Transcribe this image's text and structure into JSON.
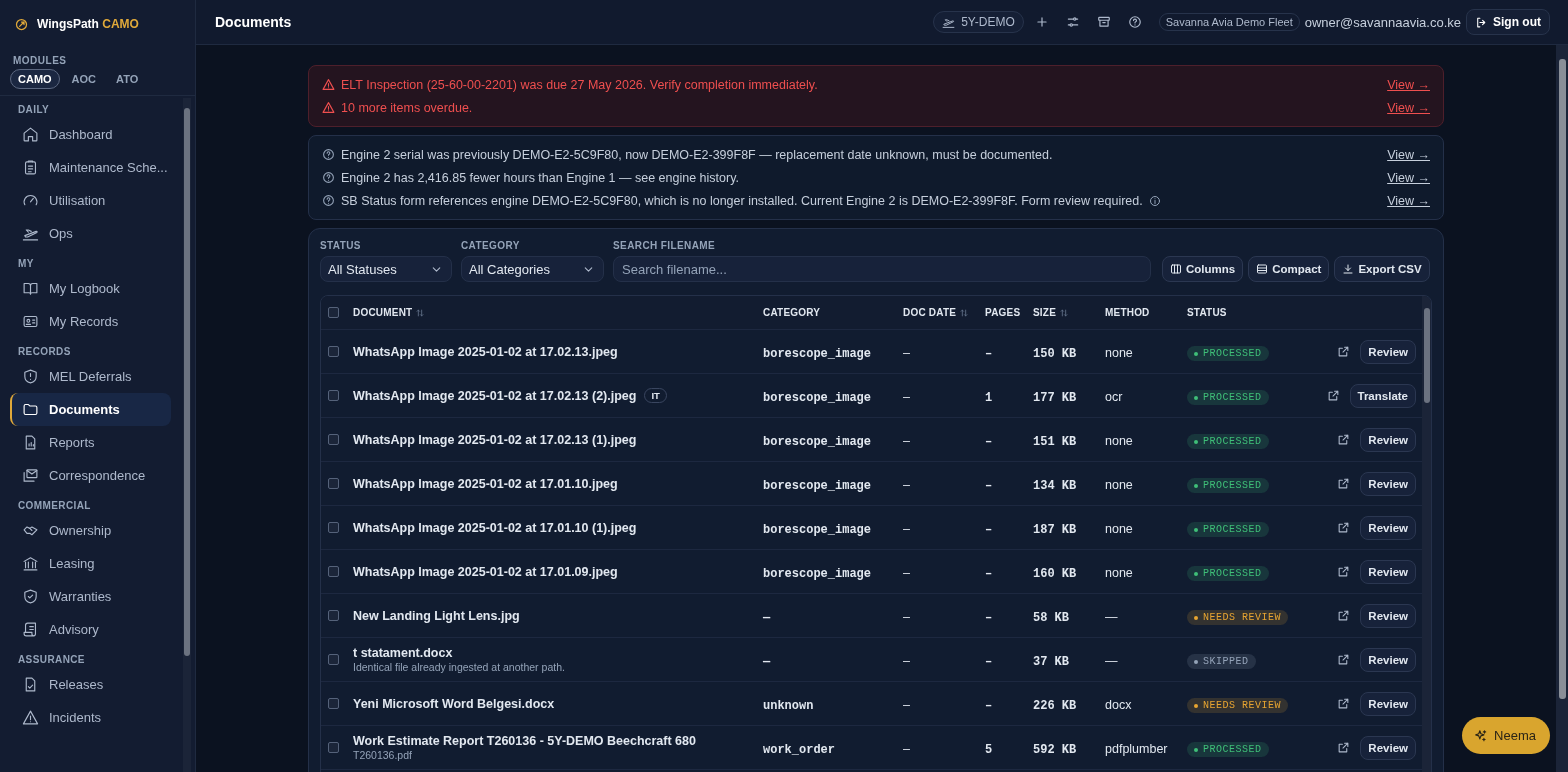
{
  "brand": {
    "name": "WingsPath",
    "product": "CAMO"
  },
  "modules": {
    "label": "MODULES",
    "items": [
      {
        "label": "CAMO",
        "selected": true
      },
      {
        "label": "AOC",
        "selected": false
      },
      {
        "label": "ATO",
        "selected": false
      }
    ]
  },
  "sidebar": {
    "sections": [
      {
        "title": "DAILY",
        "items": [
          {
            "label": "Dashboard",
            "selected": false
          },
          {
            "label": "Maintenance Sche...",
            "selected": false
          },
          {
            "label": "Utilisation",
            "selected": false
          },
          {
            "label": "Ops",
            "selected": false
          }
        ]
      },
      {
        "title": "MY",
        "items": [
          {
            "label": "My Logbook",
            "selected": false
          },
          {
            "label": "My Records",
            "selected": false
          }
        ]
      },
      {
        "title": "RECORDS",
        "items": [
          {
            "label": "MEL Deferrals",
            "selected": false
          },
          {
            "label": "Documents",
            "selected": true
          },
          {
            "label": "Reports",
            "selected": false
          },
          {
            "label": "Correspondence",
            "selected": false
          }
        ]
      },
      {
        "title": "COMMERCIAL",
        "items": [
          {
            "label": "Ownership",
            "selected": false
          },
          {
            "label": "Leasing",
            "selected": false
          },
          {
            "label": "Warranties",
            "selected": false
          },
          {
            "label": "Advisory",
            "selected": false
          }
        ]
      },
      {
        "title": "ASSURANCE",
        "items": [
          {
            "label": "Releases",
            "selected": false
          },
          {
            "label": "Incidents",
            "selected": false
          }
        ]
      }
    ]
  },
  "topbar": {
    "title": "Documents",
    "aircraft": "5Y-DEMO",
    "fleet": "Savanna Avia Demo Fleet",
    "user": "owner@savannaavia.co.ke",
    "sign_out": "Sign out"
  },
  "alerts": [
    {
      "text": "ELT Inspection (25-60-00-2201) was due 27 May 2026. Verify completion immediately.",
      "link": "View →"
    },
    {
      "text": "10 more items overdue.",
      "link": "View →"
    }
  ],
  "notices": [
    {
      "text": "Engine 2 serial was previously DEMO-E2-5C9F80, now DEMO-E2-399F8F — replacement date unknown, must be documented.",
      "info": false,
      "link": "View →"
    },
    {
      "text": "Engine 2 has 2,416.85 fewer hours than Engine 1 — see engine history.",
      "info": false,
      "link": "View →"
    },
    {
      "text": "SB Status form references engine DEMO-E2-5C9F80, which is no longer installed. Current Engine 2 is DEMO-E2-399F8F. Form review required.",
      "info": true,
      "link": "View →"
    }
  ],
  "filters": {
    "status": {
      "label": "STATUS",
      "value": "All Statuses"
    },
    "category": {
      "label": "CATEGORY",
      "value": "All Categories"
    },
    "search": {
      "label": "SEARCH FILENAME",
      "placeholder": "Search filename..."
    },
    "buttons": [
      "Columns",
      "Compact",
      "Export CSV"
    ]
  },
  "table": {
    "all_checked": false,
    "columns": [
      {
        "label": "DOCUMENT",
        "sortable": true
      },
      {
        "label": "CATEGORY",
        "sortable": false
      },
      {
        "label": "DOC DATE",
        "sortable": true
      },
      {
        "label": "PAGES",
        "sortable": false
      },
      {
        "label": "SIZE",
        "sortable": true
      },
      {
        "label": "METHOD",
        "sortable": false
      },
      {
        "label": "STATUS",
        "sortable": false
      }
    ],
    "rows": [
      {
        "checked": false,
        "document": "WhatsApp Image 2025-01-02 at 17.02.13.jpeg",
        "category": "borescope_image",
        "doc_date": "–",
        "pages": "–",
        "size": "150 KB",
        "method": "none",
        "status": "PROCESSED",
        "color": "#3fbf78",
        "action": "Review"
      },
      {
        "checked": false,
        "document": "WhatsApp Image 2025-01-02 at 17.02.13 (2).jpeg",
        "tag": "IT",
        "category": "borescope_image",
        "doc_date": "–",
        "pages": "1",
        "size": "177 KB",
        "method": "ocr",
        "status": "PROCESSED",
        "color": "#3fbf78",
        "action": "Translate"
      },
      {
        "checked": false,
        "document": "WhatsApp Image 2025-01-02 at 17.02.13 (1).jpeg",
        "category": "borescope_image",
        "doc_date": "–",
        "pages": "–",
        "size": "151 KB",
        "method": "none",
        "status": "PROCESSED",
        "color": "#3fbf78",
        "action": "Review"
      },
      {
        "checked": false,
        "document": "WhatsApp Image 2025-01-02 at 17.01.10.jpeg",
        "category": "borescope_image",
        "doc_date": "–",
        "pages": "–",
        "size": "134 KB",
        "method": "none",
        "status": "PROCESSED",
        "color": "#3fbf78",
        "action": "Review"
      },
      {
        "checked": false,
        "document": "WhatsApp Image 2025-01-02 at 17.01.10 (1).jpeg",
        "category": "borescope_image",
        "doc_date": "–",
        "pages": "–",
        "size": "187 KB",
        "method": "none",
        "status": "PROCESSED",
        "color": "#3fbf78",
        "action": "Review"
      },
      {
        "checked": false,
        "document": "WhatsApp Image 2025-01-02 at 17.01.09.jpeg",
        "category": "borescope_image",
        "doc_date": "–",
        "pages": "–",
        "size": "160 KB",
        "method": "none",
        "status": "PROCESSED",
        "color": "#3fbf78",
        "action": "Review"
      },
      {
        "checked": false,
        "document": "New Landing Light Lens.jpg",
        "category": "—",
        "doc_date": "–",
        "pages": "–",
        "size": "58 KB",
        "method": "—",
        "status": "NEEDS REVIEW",
        "color": "#e8a531",
        "action": "Review"
      },
      {
        "checked": false,
        "document": "t statament.docx",
        "note": "Identical file already ingested at another path.",
        "category": "—",
        "doc_date": "–",
        "pages": "–",
        "size": "37 KB",
        "method": "—",
        "status": "SKIPPED",
        "color": "#94a3b8",
        "action": "Review"
      },
      {
        "checked": false,
        "document": "Yeni Microsoft Word Belgesi.docx",
        "category": "unknown",
        "doc_date": "–",
        "pages": "–",
        "size": "226 KB",
        "method": "docx",
        "status": "NEEDS REVIEW",
        "color": "#e8a531",
        "action": "Review"
      },
      {
        "checked": false,
        "document": "Work Estimate Report T260136 - 5Y-DEMO Beechcraft 680",
        "note": "T260136.pdf",
        "category": "work_order",
        "doc_date": "–",
        "pages": "5",
        "size": "592 KB",
        "method": "pdfplumber",
        "status": "PROCESSED",
        "color": "#3fbf78",
        "action": "Review"
      }
    ]
  },
  "assistant": {
    "label": "Neema"
  }
}
